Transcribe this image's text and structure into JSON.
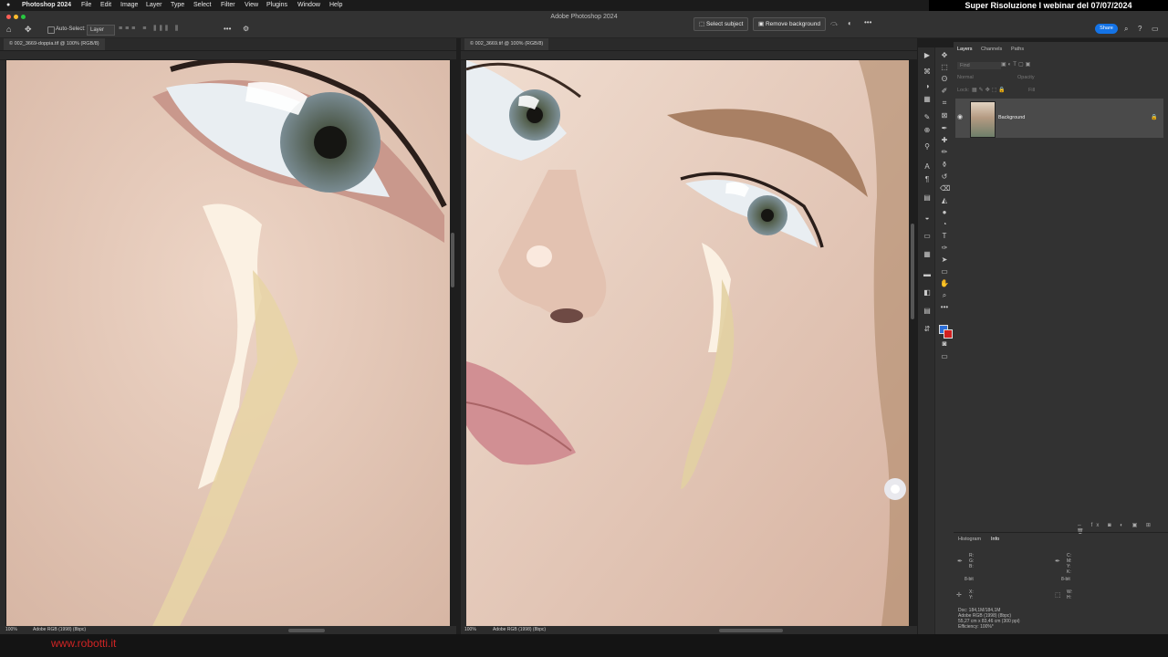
{
  "menubar": {
    "app": "Photoshop 2024",
    "items": [
      "File",
      "Edit",
      "Image",
      "Layer",
      "Type",
      "Select",
      "Filter",
      "View",
      "Plugins",
      "Window",
      "Help"
    ],
    "banner": "Super Risoluzione I webinar del 07/07/2024"
  },
  "window": {
    "title": "Adobe Photoshop 2024"
  },
  "options": {
    "auto_select": "Auto-Select:",
    "target": "Layer",
    "select_subject": "Select subject",
    "remove_background": "Remove background",
    "share": "Share"
  },
  "docs": [
    {
      "tab": "© 002_3669-doppia.tif @ 100% (RGB/8)",
      "zoom": "100%",
      "profile": "Adobe RGB (1998) (8bpc)"
    },
    {
      "tab": "© 002_3669.tif @ 100% (RGB/8)",
      "zoom": "100%",
      "profile": "Adobe RGB (1998) (8bpc)"
    }
  ],
  "panels": {
    "tabs": [
      "Layers",
      "Channels",
      "Paths"
    ],
    "find": "Find",
    "blend": "Normal",
    "opacity": "Opacity",
    "lock": "Lock:",
    "fill": "Fill",
    "layer_name": "Background",
    "info_tabs": [
      "Histogram",
      "Info"
    ]
  },
  "info": {
    "rgb": "R:\nG:\nB:",
    "cmyk": "C:\nM:\nY:\nK:",
    "bit1": "8-bit",
    "bit2": "8-bit",
    "xy": "X:\nY:",
    "wh": "W:\nH:",
    "doc": "Doc: 184,1M/184,1M",
    "profile": "Adobe RGB (1998) (8bpc)",
    "size": "55,27 cm x 83,46 cm (300 ppi)",
    "efficiency": "Efficiency: 100%*"
  },
  "footer": {
    "url": "www.robotti.it"
  },
  "colors": {
    "accent": "#1473e6",
    "url": "#d02424",
    "fg_swatch": "#2d6fd8",
    "bg_swatch": "#d21f1f"
  }
}
